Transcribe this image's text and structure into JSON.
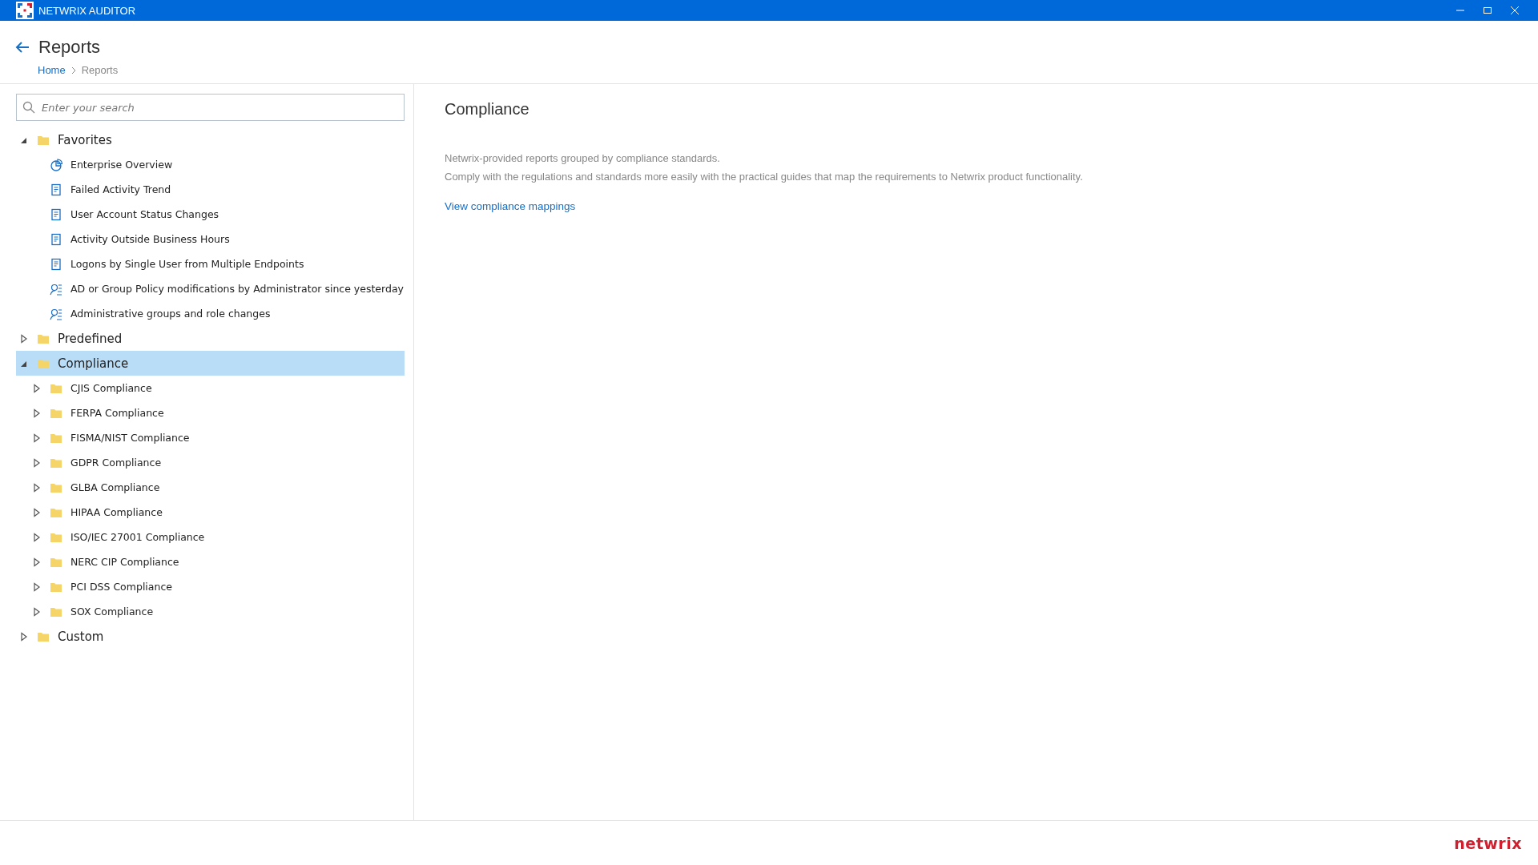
{
  "window": {
    "title": "NETWRIX AUDITOR"
  },
  "header": {
    "title": "Reports",
    "breadcrumb": [
      {
        "label": "Home",
        "kind": "link"
      },
      {
        "label": "Reports",
        "kind": "current"
      }
    ]
  },
  "search": {
    "placeholder": "Enter your search"
  },
  "tree": [
    {
      "label": "Favorites",
      "kind": "folder",
      "expanded": true,
      "selected": false,
      "children": [
        {
          "label": "Enterprise Overview",
          "kind": "chart",
          "selected": false
        },
        {
          "label": "Failed Activity Trend",
          "kind": "report",
          "selected": false
        },
        {
          "label": "User Account Status Changes",
          "kind": "report",
          "selected": false
        },
        {
          "label": "Activity Outside Business Hours",
          "kind": "report",
          "selected": false
        },
        {
          "label": "Logons by Single User from Multiple Endpoints",
          "kind": "report",
          "selected": false
        },
        {
          "label": "AD or Group Policy modifications by Administrator since yesterday",
          "kind": "search",
          "selected": false
        },
        {
          "label": "Administrative groups and role changes",
          "kind": "search",
          "selected": false
        }
      ]
    },
    {
      "label": "Predefined",
      "kind": "folder",
      "expanded": false,
      "selected": false
    },
    {
      "label": "Compliance",
      "kind": "folder",
      "expanded": true,
      "selected": true,
      "children": [
        {
          "label": "CJIS Compliance",
          "kind": "folder",
          "expanded": false,
          "selected": false
        },
        {
          "label": "FERPA Compliance",
          "kind": "folder",
          "expanded": false,
          "selected": false
        },
        {
          "label": "FISMA/NIST Compliance",
          "kind": "folder",
          "expanded": false,
          "selected": false
        },
        {
          "label": "GDPR Compliance",
          "kind": "folder",
          "expanded": false,
          "selected": false
        },
        {
          "label": "GLBA Compliance",
          "kind": "folder",
          "expanded": false,
          "selected": false
        },
        {
          "label": "HIPAA Compliance",
          "kind": "folder",
          "expanded": false,
          "selected": false
        },
        {
          "label": "ISO/IEC 27001 Compliance",
          "kind": "folder",
          "expanded": false,
          "selected": false
        },
        {
          "label": "NERC CIP Compliance",
          "kind": "folder",
          "expanded": false,
          "selected": false
        },
        {
          "label": "PCI DSS Compliance",
          "kind": "folder",
          "expanded": false,
          "selected": false
        },
        {
          "label": "SOX Compliance",
          "kind": "folder",
          "expanded": false,
          "selected": false
        }
      ]
    },
    {
      "label": "Custom",
      "kind": "folder",
      "expanded": false,
      "selected": false
    }
  ],
  "detail": {
    "title": "Compliance",
    "lines": [
      "Netwrix-provided reports grouped by compliance standards.",
      "Comply with the regulations and standards more easily with the practical guides that map the requirements to Netwrix product functionality."
    ],
    "link": "View compliance mappings"
  },
  "footer": {
    "logo": "netwrix"
  }
}
